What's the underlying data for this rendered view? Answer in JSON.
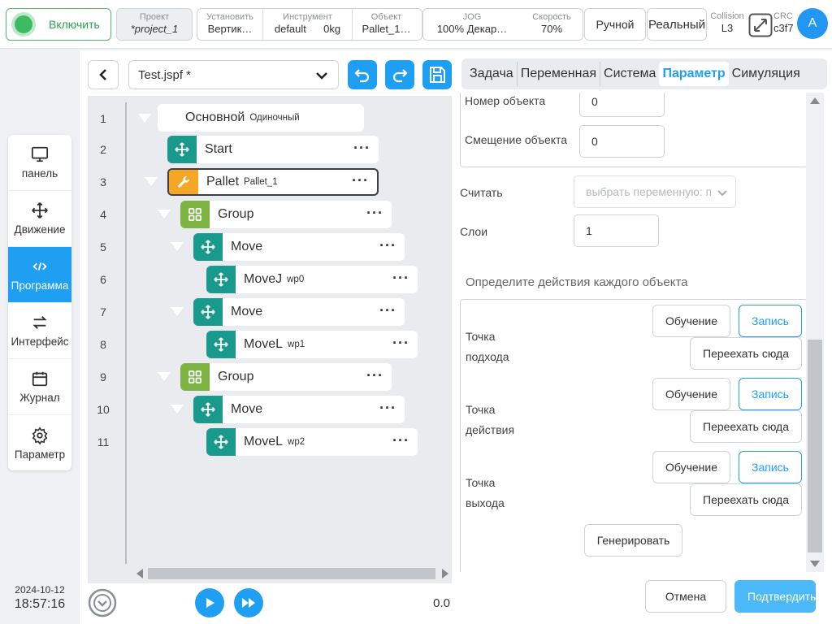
{
  "topbar": {
    "power_label": "Включить",
    "project": {
      "caption": "Проект",
      "value": "*project_1"
    },
    "install": {
      "caption": "Установить",
      "value": "Вертик…"
    },
    "tool": {
      "caption": "Инструмент",
      "value1": "default",
      "value2": "0kg"
    },
    "object": {
      "caption": "Объект",
      "value": "Pallet_1…"
    },
    "jog": {
      "caption": "JOG",
      "value1": "100%",
      "value2": "Декар…"
    },
    "speed": {
      "caption": "Скорость",
      "value": "70%"
    },
    "mode_label": "Ручной",
    "real_label": "Реальный",
    "collision": {
      "caption": "Collision",
      "value": "L3"
    },
    "crc": {
      "caption": "CRC",
      "value": "c3f7"
    },
    "avatar_letter": "A",
    "colors": {
      "accent": "#1e9ff2",
      "power_green": "#3dbb62"
    }
  },
  "leftnav": {
    "items": [
      {
        "label": "панель",
        "icon": "monitor-icon"
      },
      {
        "label": "Движение",
        "icon": "move-arrows-icon"
      },
      {
        "label": "Программа",
        "icon": "code-icon",
        "active": true
      },
      {
        "label": "Интерфейс",
        "icon": "swap-arrows-icon"
      },
      {
        "label": "Журнал",
        "icon": "calendar-icon"
      },
      {
        "label": "Параметр",
        "icon": "gear-icon"
      }
    ],
    "date": "2024-10-12",
    "time": "18:57:16"
  },
  "program": {
    "file_name": "Test.jspf *",
    "tree": [
      {
        "line": "1",
        "label": "Основной",
        "sub": "Одиночный"
      },
      {
        "line": "2",
        "label": "Start",
        "sub": ""
      },
      {
        "line": "3",
        "label": "Pallet",
        "sub": "Pallet_1"
      },
      {
        "line": "4",
        "label": "Group",
        "sub": ""
      },
      {
        "line": "5",
        "label": "Move",
        "sub": ""
      },
      {
        "line": "6",
        "label": "MoveJ",
        "sub": "wp0"
      },
      {
        "line": "7",
        "label": "Move",
        "sub": ""
      },
      {
        "line": "8",
        "label": "MoveL",
        "sub": "wp1"
      },
      {
        "line": "9",
        "label": "Group",
        "sub": ""
      },
      {
        "line": "10",
        "label": "Move",
        "sub": ""
      },
      {
        "line": "11",
        "label": "MoveL",
        "sub": "wp2"
      }
    ],
    "speed_value": "0.0",
    "colors": {
      "move": "#1a9a8c",
      "pallet": "#f5a623",
      "group": "#7cb342"
    }
  },
  "tabs": [
    "Задача",
    "Переменная",
    "Система",
    "Параметр",
    "Симуляция"
  ],
  "form": {
    "object_number": {
      "label": "Номер объекта",
      "value": "0"
    },
    "object_offset": {
      "label": "Смещение объекта",
      "value": "0"
    },
    "read": {
      "label": "Считать",
      "placeholder": "выбрать переменную: п"
    },
    "layers": {
      "label": "Слои",
      "value": "1"
    },
    "actions_title": "Определите действия каждого объекта",
    "points": [
      {
        "line1": "Точка",
        "line2": "подхода"
      },
      {
        "line1": "Точка",
        "line2": "действия"
      },
      {
        "line1": "Точка",
        "line2": "выхода"
      }
    ],
    "teach_label": "Обучение",
    "record_label": "Запись",
    "moveto_label": "Переехать сюда",
    "generate_label": "Генерировать",
    "cancel_label": "Отмена",
    "confirm_label": "Подтвердить"
  }
}
